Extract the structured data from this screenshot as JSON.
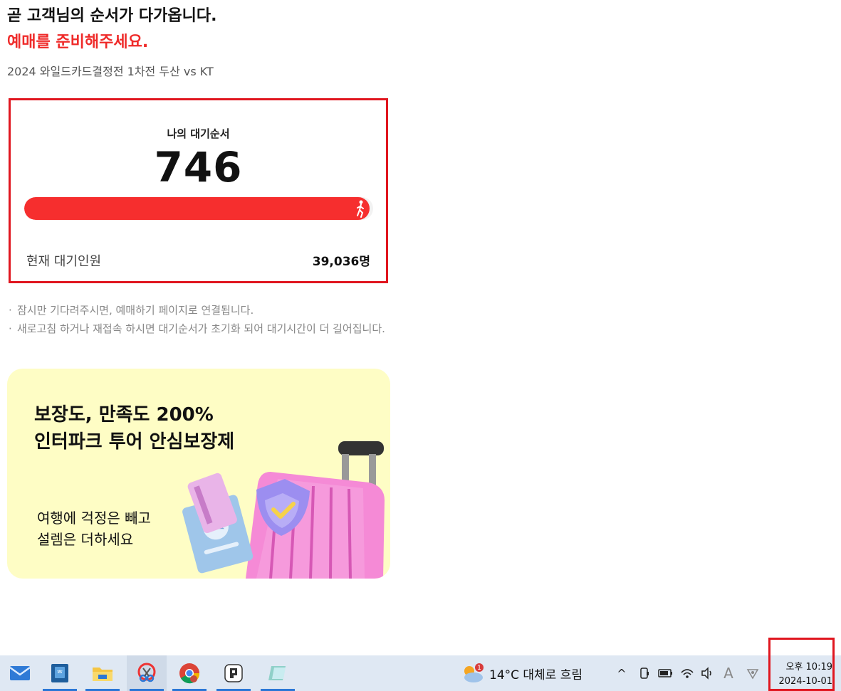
{
  "header": {
    "line1": "곧 고객님의 순서가 다가옵니다.",
    "line2": "예매를 준비해주세요.",
    "event_title": "2024 와일드카드결정전 1차전 두산 vs KT"
  },
  "queue": {
    "label": "나의 대기순서",
    "position": "746",
    "progress_fraction": 0.99,
    "waiting_label": "현재 대기인원",
    "waiting_count": "39,036명"
  },
  "notices": [
    "잠시만 기다려주시면, 예매하기 페이지로 연결됩니다.",
    "새로고침 하거나 재접속 하시면 대기순서가 초기화 되어 대기시간이 더 길어집니다."
  ],
  "banner": {
    "title_line1": "보장도, 만족도 200%",
    "title_line2": "인터파크 투어 안심보장제",
    "sub_line1": "여행에 걱정은 빼고",
    "sub_line2": "설렘은 더하세요"
  },
  "taskbar": {
    "apps": [
      "mail-icon",
      "app-icon",
      "file-explorer-icon",
      "snip-tool-icon",
      "chrome-icon",
      "app-icon-2",
      "notepad-icon"
    ],
    "weather_badge": "1",
    "weather": "14°C  대체로 흐림",
    "clock_time": "오후 10:19",
    "clock_date": "2024-10-01"
  },
  "colors": {
    "accent_red": "#ef2b2a",
    "progress_red": "#f62e2e",
    "banner_bg": "#fefdc5",
    "highlight_border": "#e0161f"
  }
}
